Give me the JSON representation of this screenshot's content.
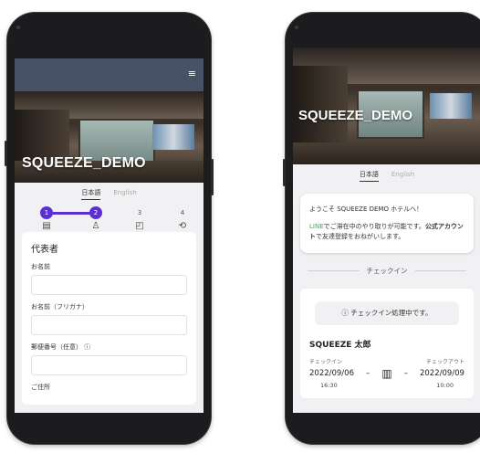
{
  "left": {
    "hotel_name": "SQUEEZE_DEMO",
    "lang": {
      "ja": "日本語",
      "en": "English"
    },
    "steps": [
      {
        "num": "1",
        "icon": "▤"
      },
      {
        "num": "2",
        "icon": "♙"
      },
      {
        "num": "3",
        "icon": "◰"
      },
      {
        "num": "4",
        "icon": "⟲"
      }
    ],
    "form": {
      "section": "代表者",
      "name_label": "お名前",
      "kana_label": "お名前（フリガナ）",
      "postal_label": "郵便番号（任意） ⓘ",
      "address_label": "ご住所"
    }
  },
  "right": {
    "hotel_name": "SQUEEZE_DEMO",
    "lang": {
      "ja": "日本語",
      "en": "English"
    },
    "welcome_line1": "ようこそ SQUEEZE DEMO ホテルへ！",
    "line_word": "LINE",
    "welcome_line2": "でご滞在中のやり取りが可能です。",
    "bold_text": "公式アカウント",
    "welcome_line3": "で友達登録をおねがいします。",
    "section": "チェックイン",
    "status": "ⓘ チェックイン処理中です。",
    "guest": "SQUEEZE 太郎",
    "checkin_label": "チェックイン",
    "checkout_label": "チェックアウト",
    "checkin_date": "2022/09/06",
    "checkout_date": "2022/09/09",
    "checkin_time": "16:30",
    "checkout_time": "10:00",
    "dash1": "–",
    "dash2": "–"
  }
}
